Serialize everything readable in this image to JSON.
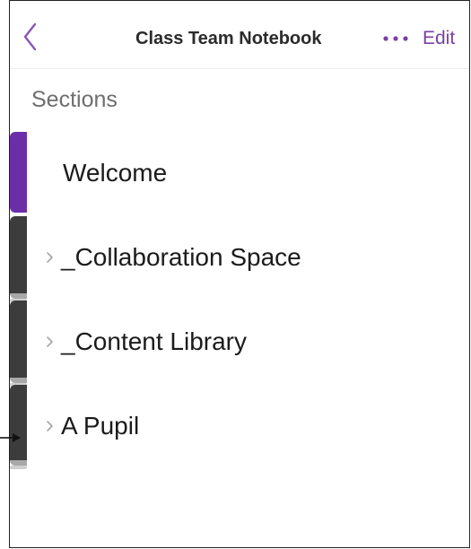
{
  "navbar": {
    "back_icon": "chevron-left-icon",
    "title": "Class Team Notebook",
    "more_icon": "ellipsis-icon",
    "edit_label": "Edit"
  },
  "sections_heading": "Sections",
  "sections": [
    {
      "label": "Welcome",
      "expandable": false,
      "tab_color": "#6b2ea8",
      "selected": true
    },
    {
      "label": "_Collaboration Space",
      "expandable": true,
      "tab_color": "#3c3c3c",
      "selected": false
    },
    {
      "label": "_Content Library",
      "expandable": true,
      "tab_color": "#3c3c3c",
      "selected": false
    },
    {
      "label": "A Pupil",
      "expandable": true,
      "tab_color": "#3c3c3c",
      "selected": false
    }
  ],
  "colors": {
    "accent": "#7a3fa6",
    "selected_tab": "#6b2ea8",
    "section_group_tab": "#3c3c3c"
  }
}
